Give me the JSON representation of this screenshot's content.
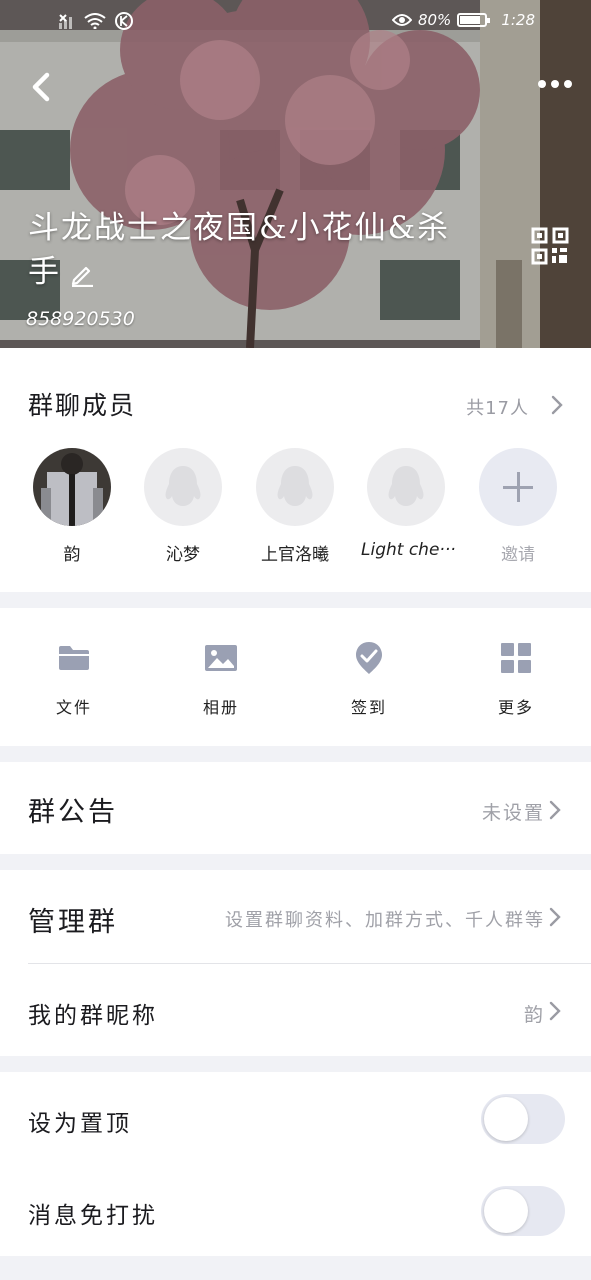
{
  "status_bar": {
    "battery_percent": "80%",
    "time": "1:28",
    "icons": [
      "signal-off-icon",
      "wifi-icon",
      "nfc-icon",
      "eye-icon",
      "battery-icon"
    ]
  },
  "header": {
    "title": "斗龙战士之夜国&小花仙&杀手",
    "group_id": "858920530"
  },
  "members": {
    "title": "群聊成员",
    "count_label": "共17人",
    "list": [
      {
        "name": "韵"
      },
      {
        "name": "沁梦"
      },
      {
        "name": "上官洛曦"
      },
      {
        "name": "Light che···"
      }
    ],
    "invite_label": "邀请"
  },
  "tools": [
    {
      "label": "文件",
      "icon": "folder-icon"
    },
    {
      "label": "相册",
      "icon": "image-icon"
    },
    {
      "label": "签到",
      "icon": "checkin-icon"
    },
    {
      "label": "更多",
      "icon": "grid-icon"
    }
  ],
  "announcement": {
    "label": "群公告",
    "value": "未设置"
  },
  "manage": {
    "label": "管理群",
    "value": "设置群聊资料、加群方式、千人群等"
  },
  "nickname": {
    "label": "我的群昵称",
    "value": "韵"
  },
  "pin_top": {
    "label": "设为置顶",
    "on": false
  },
  "mute": {
    "label": "消息免打扰",
    "on": false
  },
  "colors": {
    "accent_gray": "#9a9ba3",
    "page_bg": "#f1f2f6",
    "toggle_off": "#e6e8f1"
  }
}
